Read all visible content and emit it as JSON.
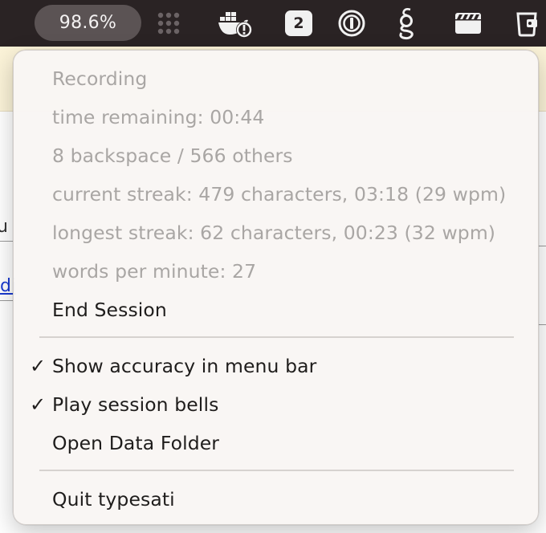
{
  "menubar": {
    "accuracy": "98.6%",
    "notification_count": "2"
  },
  "menu": {
    "stats": [
      "Recording",
      "time remaining: 00:44",
      "8 backspace / 566 others",
      "current streak: 479 characters, 03:18 (29 wpm)",
      "longest streak: 62 characters, 00:23 (32 wpm)",
      "words per minute: 27"
    ],
    "end_session": "End Session",
    "show_accuracy": "Show accuracy in menu bar",
    "play_bells": "Play session bells",
    "open_data_folder": "Open Data Folder",
    "quit": "Quit typesati"
  }
}
